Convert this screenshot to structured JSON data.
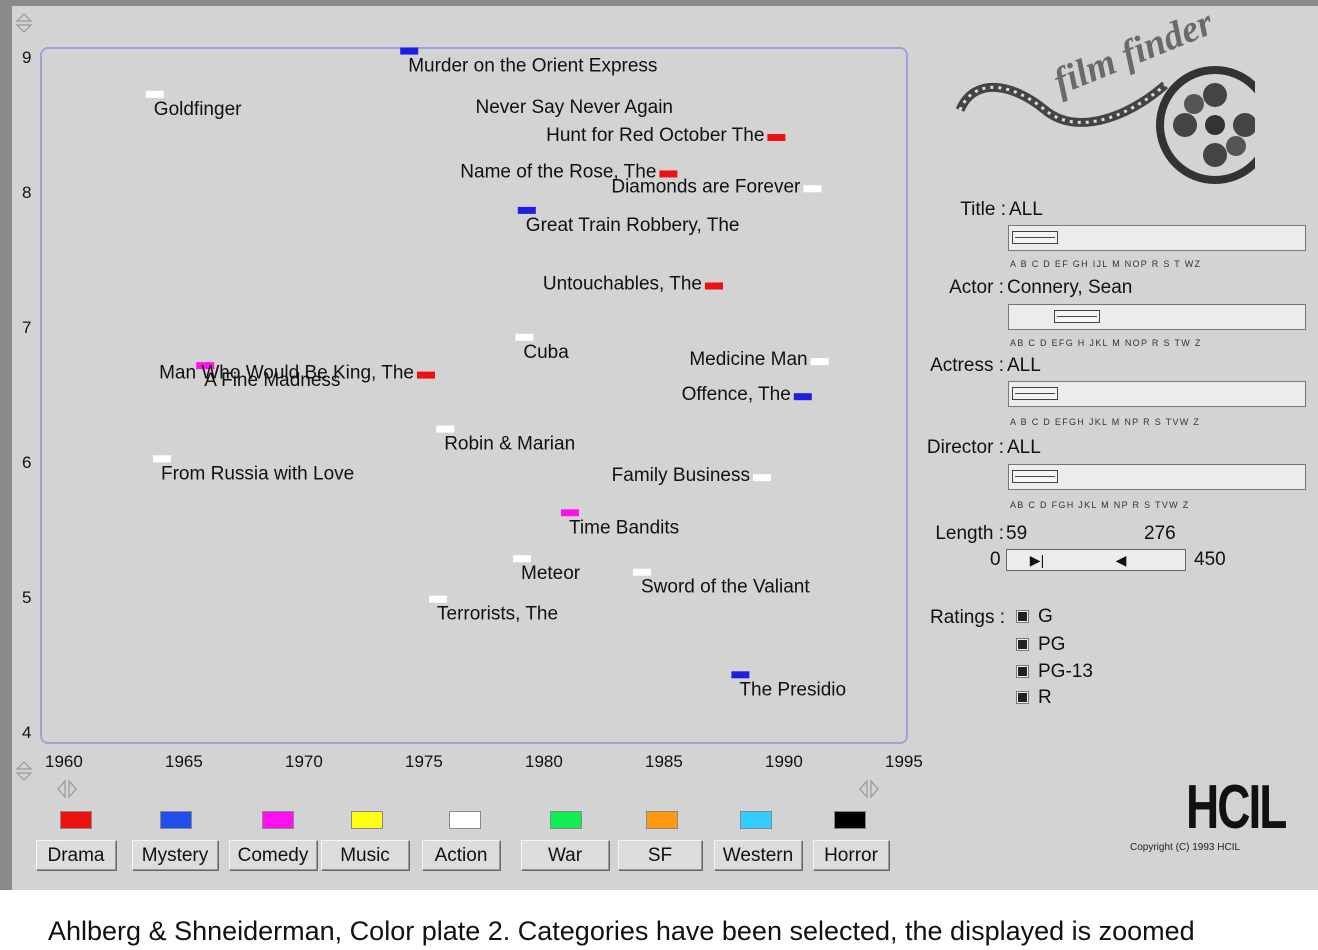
{
  "plot": {
    "x_ticks": [
      "1960",
      "1965",
      "1970",
      "1975",
      "1980",
      "1985",
      "1990",
      "1995"
    ],
    "y_ticks": [
      "9",
      "8",
      "7",
      "6",
      "5",
      "4"
    ],
    "x_range": [
      1960,
      1995
    ],
    "y_range": [
      4,
      9
    ],
    "movies": [
      {
        "label": "Murder on the Orient Express",
        "year": 1974.3,
        "rating": 9.04,
        "color": "#1f1fe0"
      },
      {
        "label": "Goldfinger",
        "year": 1963.7,
        "rating": 8.72,
        "color": "#ffffff"
      },
      {
        "label": "Never Say Never Again",
        "year": 1983.0,
        "rating": 8.6,
        "color": "#ffffff",
        "marker": false
      },
      {
        "label": "Hunt for Red October  The",
        "year": 1989.6,
        "rating": 8.4,
        "color": "#ee1111",
        "label_side": "left"
      },
      {
        "label": "Name of the Rose, The",
        "year": 1985.1,
        "rating": 8.13,
        "color": "#ee1111",
        "label_side": "left"
      },
      {
        "label": "Diamonds are Forever",
        "year": 1991.1,
        "rating": 8.02,
        "color": "#ffffff",
        "label_side": "left"
      },
      {
        "label": "Great Train Robbery, The",
        "year": 1979.2,
        "rating": 7.86,
        "color": "#1f1fe0"
      },
      {
        "label": "Untouchables, The",
        "year": 1987.0,
        "rating": 7.3,
        "color": "#ee1111",
        "label_side": "left"
      },
      {
        "label": "Cuba",
        "year": 1979.1,
        "rating": 6.92,
        "color": "#ffffff"
      },
      {
        "label": "A Fine Madness",
        "year": 1965.8,
        "rating": 6.71,
        "color": "#ff11ee"
      },
      {
        "label": "Man Who Would Be King, The",
        "year": 1975.0,
        "rating": 6.64,
        "color": "#ee1111",
        "label_side": "left"
      },
      {
        "label": "Medicine Man",
        "year": 1991.4,
        "rating": 6.74,
        "color": "#ffffff",
        "label_side": "left"
      },
      {
        "label": "Offence, The",
        "year": 1990.7,
        "rating": 6.48,
        "color": "#1f1fe0",
        "label_side": "left"
      },
      {
        "label": "Robin & Marian",
        "year": 1975.8,
        "rating": 6.24,
        "color": "#ffffff"
      },
      {
        "label": "From Russia with Love",
        "year": 1964.0,
        "rating": 6.02,
        "color": "#ffffff"
      },
      {
        "label": "Family Business",
        "year": 1989.0,
        "rating": 5.88,
        "color": "#ffffff",
        "label_side": "left"
      },
      {
        "label": "Time Bandits",
        "year": 1981.0,
        "rating": 5.62,
        "color": "#ff11ee"
      },
      {
        "label": "Meteor",
        "year": 1979.0,
        "rating": 5.28,
        "color": "#ffffff"
      },
      {
        "label": "Sword of the Valiant",
        "year": 1984.0,
        "rating": 5.18,
        "color": "#ffffff"
      },
      {
        "label": "Terrorists, The",
        "year": 1975.5,
        "rating": 4.98,
        "color": "#ffffff"
      },
      {
        "label": "The Presidio",
        "year": 1988.1,
        "rating": 4.42,
        "color": "#1f1fe0"
      }
    ]
  },
  "controls": {
    "title": {
      "label": "Title :",
      "value": "ALL",
      "alphabet": "A  B C D EF GH IJL M NOP R S  T  WZ"
    },
    "actor": {
      "label": "Actor :",
      "value": "Connery, Sean",
      "alphabet": "AB  C D EFG H JKL M  NOP R S TW Z"
    },
    "actress": {
      "label": "Actress :",
      "value": "ALL",
      "alphabet": "A B  C  D EFGH JKL M  NP R S  TVW Z"
    },
    "director": {
      "label": "Director :",
      "value": "ALL",
      "alphabet": "AB  C  D FGH JKL M  NP R S  TVW Z"
    },
    "length": {
      "label": "Length :",
      "low": "59",
      "high": "276",
      "min": "0",
      "max": "450"
    },
    "ratings": {
      "label": "Ratings :",
      "items": [
        "G",
        "PG",
        "PG-13",
        "R"
      ]
    }
  },
  "categories": [
    {
      "label": "Drama",
      "color": "#ee1111"
    },
    {
      "label": "Mystery",
      "color": "#1f4fee"
    },
    {
      "label": "Comedy",
      "color": "#ff11ee"
    },
    {
      "label": "Music",
      "color": "#ffff11"
    },
    {
      "label": "Action",
      "color": "#ffffff"
    },
    {
      "label": "War",
      "color": "#11ee55"
    },
    {
      "label": "SF",
      "color": "#ff9911"
    },
    {
      "label": "Western",
      "color": "#33ccff"
    },
    {
      "label": "Horror",
      "color": "#000000"
    }
  ],
  "logo": {
    "text": "film finder"
  },
  "branding": {
    "hcil": "HCIL",
    "copyright": "Copyright (C) 1993 HCIL"
  },
  "caption": "Ahlberg & Shneiderman, Color plate 2. Categories have been selected, the displayed is zoomed"
}
